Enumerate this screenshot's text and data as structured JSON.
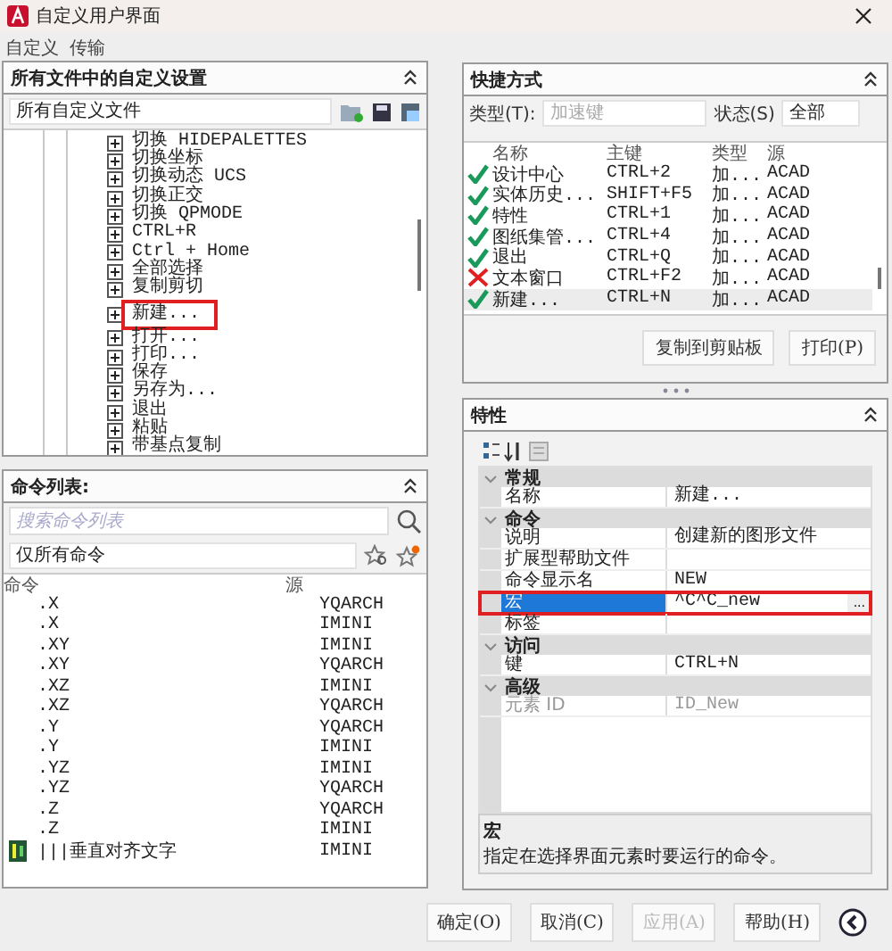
{
  "window": {
    "title": "自定义用户界面"
  },
  "menu": [
    "自定义",
    "传输"
  ],
  "customizations": {
    "title": "所有文件中的自定义设置",
    "file_select": "所有自定义文件",
    "tree": [
      {
        "label": "切换 HIDEPALETTES",
        "highlighted": false
      },
      {
        "label": "切换坐标",
        "highlighted": false
      },
      {
        "label": "切换动态 UCS",
        "highlighted": false
      },
      {
        "label": "切换正交",
        "highlighted": false
      },
      {
        "label": "切换 QPMODE",
        "highlighted": false
      },
      {
        "label": "CTRL+R",
        "highlighted": false
      },
      {
        "label": "Ctrl + Home",
        "highlighted": false
      },
      {
        "label": "全部选择",
        "highlighted": false
      },
      {
        "label": "复制剪切",
        "highlighted": false
      },
      {
        "label": "新建...",
        "highlighted": true
      },
      {
        "label": "打开...",
        "highlighted": false
      },
      {
        "label": "打印...",
        "highlighted": false
      },
      {
        "label": "保存",
        "highlighted": false
      },
      {
        "label": "另存为...",
        "highlighted": false
      },
      {
        "label": "退出",
        "highlighted": false
      },
      {
        "label": "粘贴",
        "highlighted": false
      },
      {
        "label": "带基点复制",
        "highlighted": false
      }
    ]
  },
  "command_list": {
    "title": "命令列表:",
    "search": {
      "placeholder": "搜索命令列表"
    },
    "filter": "仅所有命令",
    "columns": [
      "命令",
      "源"
    ],
    "rows": [
      {
        "command": ".X",
        "source": "YQARCH",
        "has_icon": false
      },
      {
        "command": ".X",
        "source": "IMINI",
        "has_icon": false
      },
      {
        "command": ".XY",
        "source": "IMINI",
        "has_icon": false
      },
      {
        "command": ".XY",
        "source": "YQARCH",
        "has_icon": false
      },
      {
        "command": ".XZ",
        "source": "IMINI",
        "has_icon": false
      },
      {
        "command": ".XZ",
        "source": "YQARCH",
        "has_icon": false
      },
      {
        "command": ".Y",
        "source": "YQARCH",
        "has_icon": false
      },
      {
        "command": ".Y",
        "source": "IMINI",
        "has_icon": false
      },
      {
        "command": ".YZ",
        "source": "IMINI",
        "has_icon": false
      },
      {
        "command": ".YZ",
        "source": "YQARCH",
        "has_icon": false
      },
      {
        "command": ".Z",
        "source": "YQARCH",
        "has_icon": false
      },
      {
        "command": ".Z",
        "source": "IMINI",
        "has_icon": false
      },
      {
        "command": "|||垂直对齐文字",
        "source": "IMINI",
        "has_icon": true
      }
    ]
  },
  "shortcuts": {
    "title": "快捷方式",
    "type_field": {
      "label": "类型(T):",
      "value": "加速键",
      "disabled": true
    },
    "status_field": {
      "label": "状态(S)",
      "value": "全部",
      "disabled": false
    },
    "columns": [
      "名称",
      "主键",
      "类型",
      "源"
    ],
    "rows": [
      {
        "name": "设计中心",
        "key": "CTRL+2",
        "type": "加...",
        "source": "ACAD",
        "valid": true,
        "selected": false
      },
      {
        "name": "实体历史...",
        "key": "SHIFT+F5",
        "type": "加...",
        "source": "ACAD",
        "valid": true,
        "selected": false
      },
      {
        "name": "特性",
        "key": "CTRL+1",
        "type": "加...",
        "source": "ACAD",
        "valid": true,
        "selected": false
      },
      {
        "name": "图纸集管...",
        "key": "CTRL+4",
        "type": "加...",
        "source": "ACAD",
        "valid": true,
        "selected": false
      },
      {
        "name": "退出",
        "key": "CTRL+Q",
        "type": "加...",
        "source": "ACAD",
        "valid": true,
        "selected": false
      },
      {
        "name": "文本窗口",
        "key": "CTRL+F2",
        "type": "加...",
        "source": "ACAD",
        "valid": false,
        "selected": false
      },
      {
        "name": "新建...",
        "key": "CTRL+N",
        "type": "加...",
        "source": "ACAD",
        "valid": true,
        "selected": true
      }
    ],
    "buttons": [
      "复制到剪贴板",
      "打印(P)"
    ]
  },
  "properties": {
    "title": "特性",
    "groups": [
      {
        "label": "常规",
        "expanded": true,
        "rows": [
          {
            "name": "名称",
            "value": "新建...",
            "selected": false,
            "disabled": false,
            "has_button": false,
            "highlighted": false
          }
        ]
      },
      {
        "label": "命令",
        "expanded": true,
        "rows": [
          {
            "name": "说明",
            "value": "创建新的图形文件",
            "selected": false,
            "disabled": false,
            "has_button": false,
            "highlighted": false
          },
          {
            "name": "扩展型帮助文件",
            "selected": false,
            "disabled": false,
            "has_button": false,
            "highlighted": false
          },
          {
            "name": "命令显示名",
            "value": "NEW",
            "selected": false,
            "disabled": false,
            "has_button": false,
            "highlighted": false
          },
          {
            "name": "宏",
            "value": "^C^C_new",
            "selected": true,
            "disabled": false,
            "has_button": true,
            "highlighted": true
          },
          {
            "name": "标签",
            "selected": false,
            "disabled": false,
            "has_button": false,
            "highlighted": false
          }
        ]
      },
      {
        "label": "访问",
        "expanded": true,
        "rows": [
          {
            "name": "键",
            "value": "CTRL+N",
            "selected": false,
            "disabled": false,
            "has_button": false,
            "highlighted": false
          }
        ]
      },
      {
        "label": "高级",
        "expanded": true,
        "rows": [
          {
            "name": "元素 ID",
            "value": "ID_New",
            "selected": false,
            "disabled": true,
            "has_button": false,
            "highlighted": false
          }
        ]
      }
    ],
    "browse_button": "...",
    "description": {
      "title": "宏",
      "text": "指定在选择界面元素时要运行的命令。"
    }
  },
  "buttons": [
    {
      "label": "确定(O)",
      "disabled": false
    },
    {
      "label": "取消(C)",
      "disabled": false
    },
    {
      "label": "应用(A)",
      "disabled": true
    },
    {
      "label": "帮助(H)",
      "disabled": false
    }
  ]
}
